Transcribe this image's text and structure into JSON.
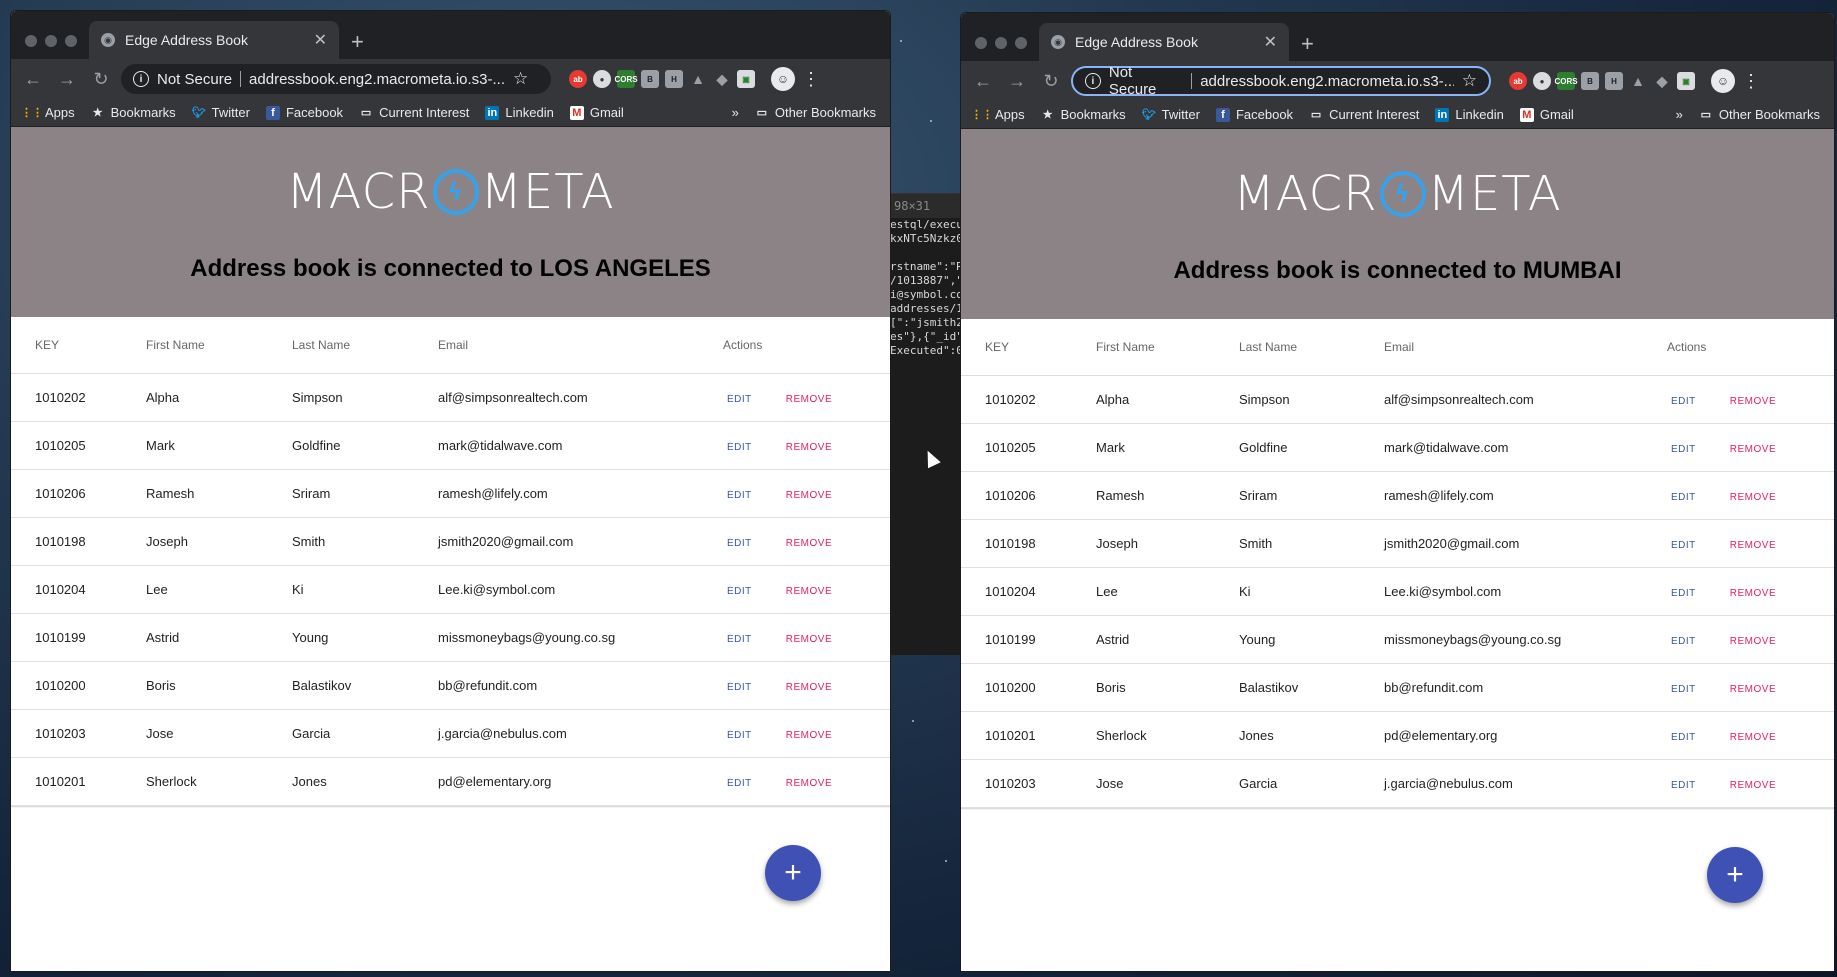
{
  "terminal": {
    "header": "98×31",
    "lines": [
      "estql/execut",
      "kxNTc5Nzkz0",
      "",
      "rstname\":\"R",
      "/1013887\",\"",
      "i@symbol.co",
      "addresses/1",
      "[\":\"jsmith2",
      "es\"},{\"_id\"",
      "Executed\":0"
    ]
  },
  "colors": {
    "accent": "#3f51b5",
    "remove": "#e91e63",
    "hero_bg": "#8b8385",
    "logo_ring": "#3aa0e8"
  },
  "left": {
    "tab_title": "Edge Address Book",
    "security": "Not Secure",
    "url": "addressbook.eng2.macrometa.io.s3-...",
    "bookmarks": [
      "Apps",
      "Bookmarks",
      "Twitter",
      "Facebook",
      "Current Interest",
      "Linkedin",
      "Gmail"
    ],
    "other_bookmarks": "Other Bookmarks",
    "logo_left": "MACR",
    "logo_right": "METa",
    "hero_title": "Address book is connected to LOS ANGELES",
    "columns": [
      "KEY",
      "First Name",
      "Last Name",
      "Email",
      "Actions"
    ],
    "edit_label": "EDIT",
    "remove_label": "REMOVE",
    "rows": [
      [
        "1010202",
        "Alpha",
        "Simpson",
        "alf@simpsonrealtech.com"
      ],
      [
        "1010205",
        "Mark",
        "Goldfine",
        "mark@tidalwave.com"
      ],
      [
        "1010206",
        "Ramesh",
        "Sriram",
        "ramesh@lifely.com"
      ],
      [
        "1010198",
        "Joseph",
        "Smith",
        "jsmith2020@gmail.com"
      ],
      [
        "1010204",
        "Lee",
        "Ki",
        "Lee.ki@symbol.com"
      ],
      [
        "1010199",
        "Astrid",
        "Young",
        "missmoneybags@young.co.sg"
      ],
      [
        "1010200",
        "Boris",
        "Balastikov",
        "bb@refundit.com"
      ],
      [
        "1010203",
        "Jose",
        "Garcia",
        "j.garcia@nebulus.com"
      ],
      [
        "1010201",
        "Sherlock",
        "Jones",
        "pd@elementary.org"
      ]
    ],
    "fab_label": "+"
  },
  "right": {
    "tab_title": "Edge Address Book",
    "security": "Not Secure",
    "url": "addressbook.eng2.macrometa.io.s3-...",
    "bookmarks": [
      "Apps",
      "Bookmarks",
      "Twitter",
      "Facebook",
      "Current Interest",
      "Linkedin",
      "Gmail"
    ],
    "other_bookmarks": "Other Bookmarks",
    "logo_left": "MACR",
    "logo_right": "METa",
    "hero_title": "Address book is connected to MUMBAI",
    "columns": [
      "KEY",
      "First Name",
      "Last Name",
      "Email",
      "Actions"
    ],
    "edit_label": "EDIT",
    "remove_label": "REMOVE",
    "rows": [
      [
        "1010202",
        "Alpha",
        "Simpson",
        "alf@simpsonrealtech.com"
      ],
      [
        "1010205",
        "Mark",
        "Goldfine",
        "mark@tidalwave.com"
      ],
      [
        "1010206",
        "Ramesh",
        "Sriram",
        "ramesh@lifely.com"
      ],
      [
        "1010198",
        "Joseph",
        "Smith",
        "jsmith2020@gmail.com"
      ],
      [
        "1010204",
        "Lee",
        "Ki",
        "Lee.ki@symbol.com"
      ],
      [
        "1010199",
        "Astrid",
        "Young",
        "missmoneybags@young.co.sg"
      ],
      [
        "1010200",
        "Boris",
        "Balastikov",
        "bb@refundit.com"
      ],
      [
        "1010201",
        "Sherlock",
        "Jones",
        "pd@elementary.org"
      ],
      [
        "1010203",
        "Jose",
        "Garcia",
        "j.garcia@nebulus.com"
      ]
    ],
    "fab_label": "+"
  }
}
